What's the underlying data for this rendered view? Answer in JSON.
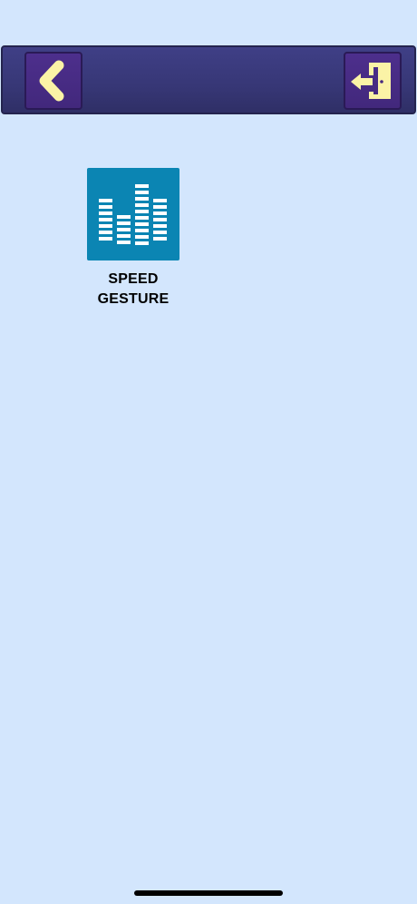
{
  "header": {
    "back_icon": "chevron-left-icon",
    "exit_icon": "exit-door-icon",
    "icon_color": "#fbf3a6",
    "bar_color": "#3a3a7c",
    "button_color": "#46297f"
  },
  "apps": [
    {
      "label_line1": "SPEED",
      "label_line2": "GESTURE",
      "icon": "equalizer-icon",
      "tile_color": "#0b85b3"
    }
  ],
  "background_color": "#d3e6fd"
}
